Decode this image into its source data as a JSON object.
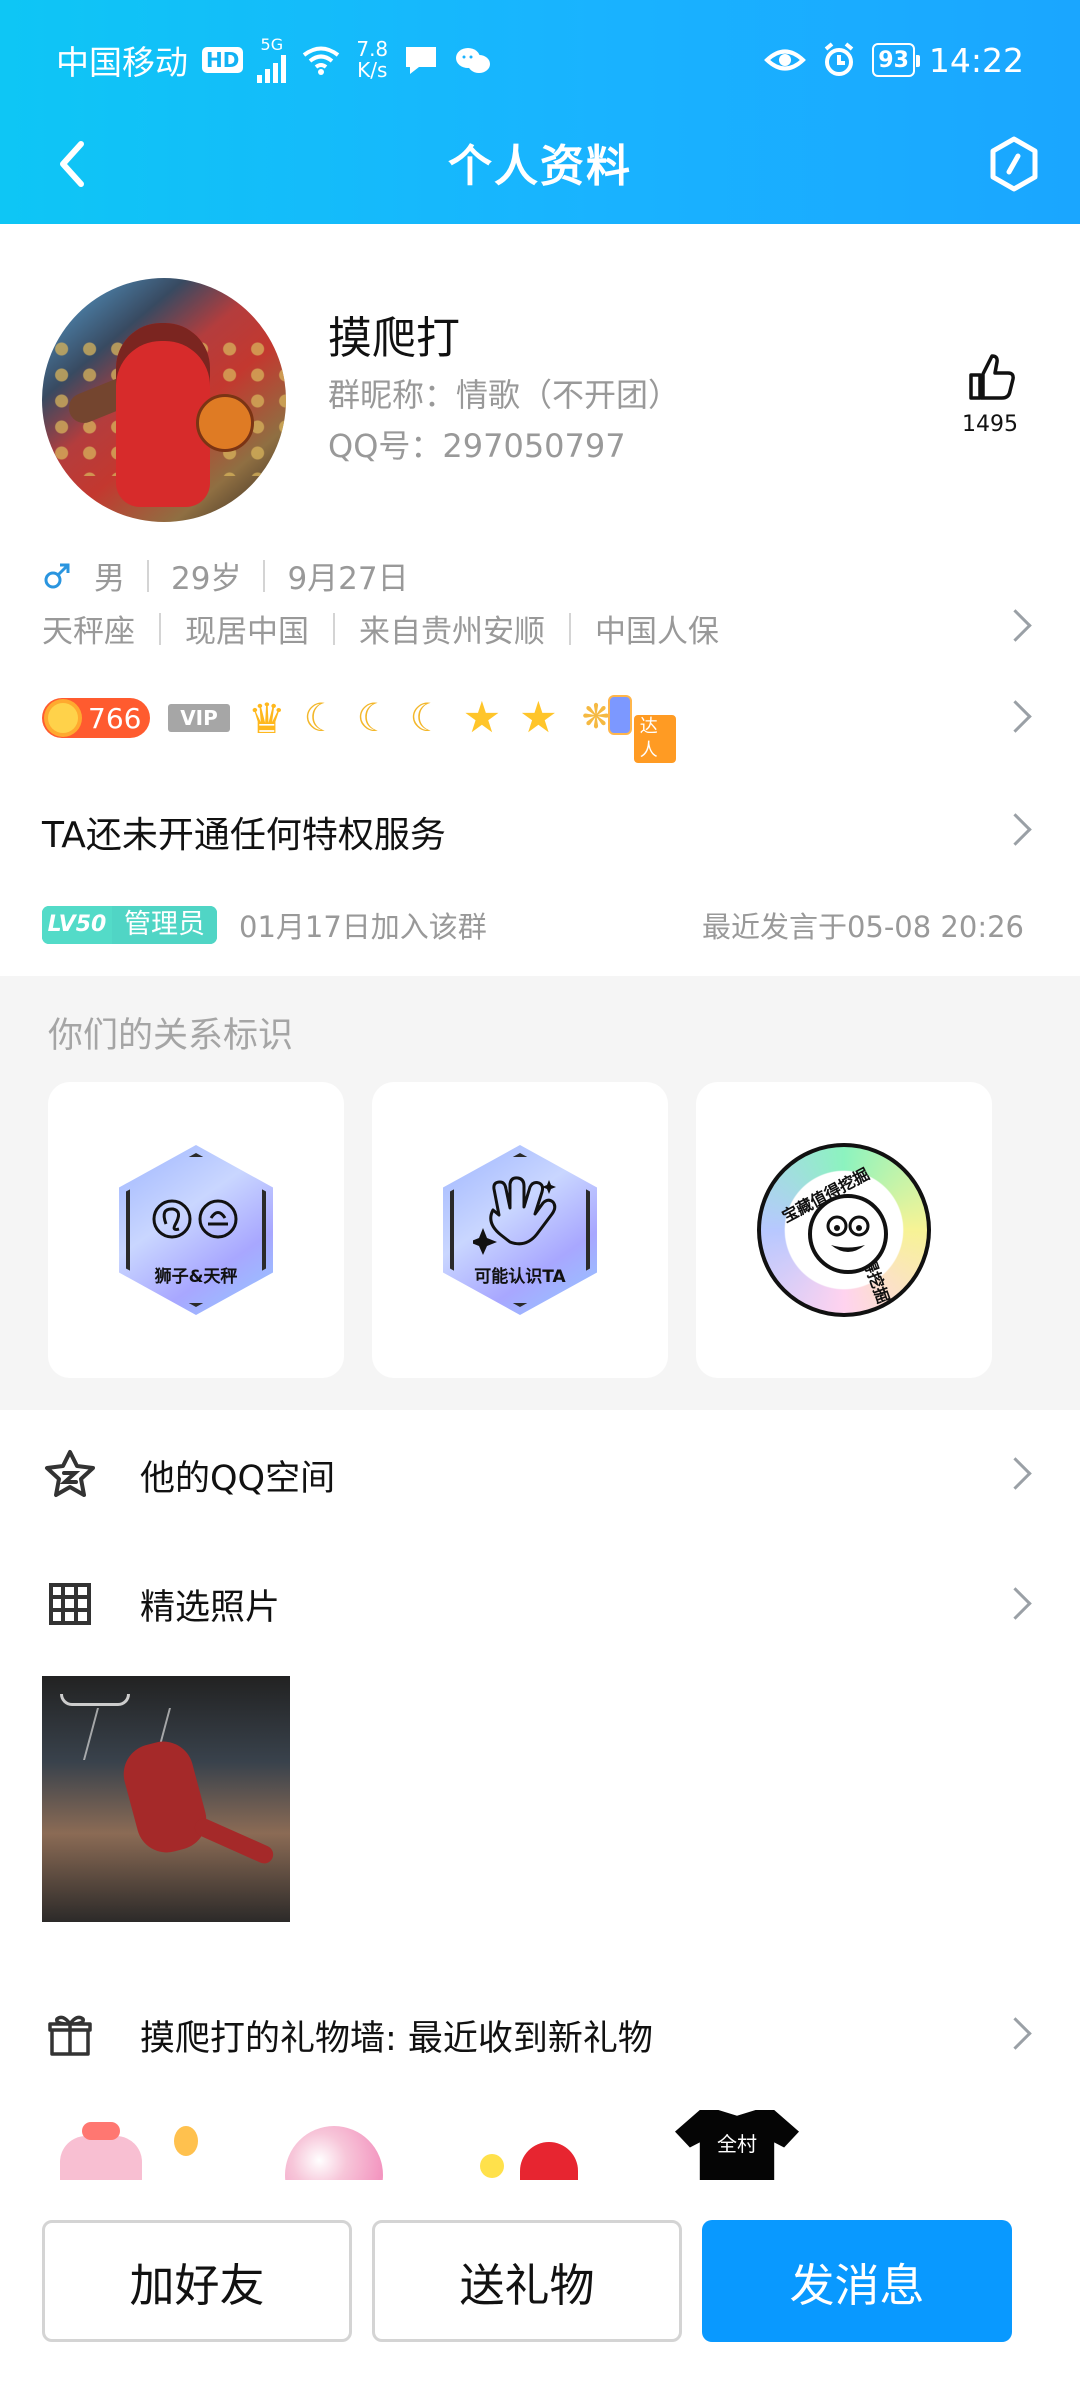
{
  "status_bar": {
    "carrier": "中国移动",
    "hd": "HD",
    "signal": "5G",
    "speed_value": "7.8",
    "speed_unit": "K/s",
    "battery": "93",
    "time": "14:22"
  },
  "header": {
    "title": "个人资料"
  },
  "profile": {
    "name": "摸爬打",
    "group_nickname": "群昵称：情歌（不开团）",
    "qq_number": "QQ号：297050797",
    "likes": "1495",
    "gender": "男",
    "age": "29岁",
    "birthday": "9月27日",
    "zodiac": "天秤座",
    "current_location": "现居中国",
    "hometown": "来自贵州安顺",
    "company": "中国人保",
    "sun_level": "766",
    "vip_label": "VIP",
    "expert_label": "达人",
    "privilege_text": "TA还未开通任何特权服务",
    "group_level": "LV50",
    "group_role": "管理员",
    "joined_text": "01月17日加入该群",
    "recent_speak": "最近发言于05-08 20:26"
  },
  "relationship": {
    "title": "你们的关系标识",
    "items": [
      {
        "label": "狮子&天秤"
      },
      {
        "label": "可能认识TA"
      },
      {
        "label": "宝藏值得挖掘"
      }
    ]
  },
  "menu": {
    "qq_space": "他的QQ空间",
    "featured_photos": "精选照片",
    "gift_wall": "摸爬打的礼物墙: 最近收到新礼物"
  },
  "gifts": [
    {
      "label": "全村"
    }
  ],
  "actions": {
    "add_friend": "加好友",
    "send_gift": "送礼物",
    "send_message": "发消息"
  },
  "colors": {
    "header_blue": "#19b3ff",
    "primary_blue": "#0999ff",
    "group_tag": "#50d5c5",
    "gray_text": "#999999"
  }
}
